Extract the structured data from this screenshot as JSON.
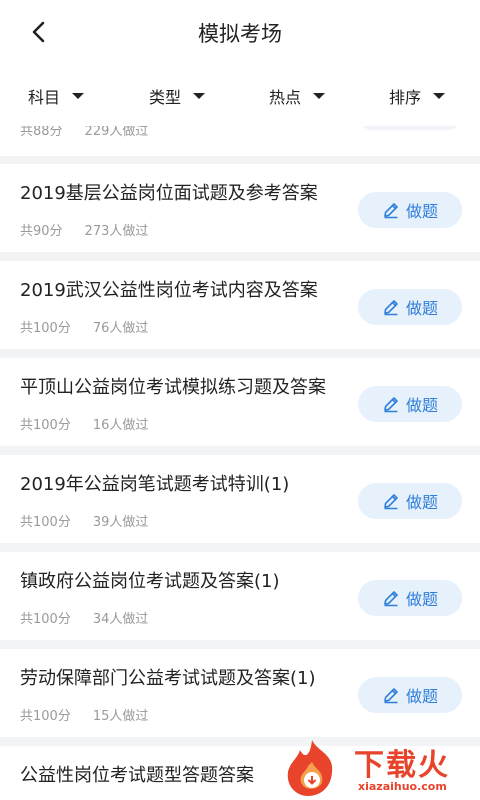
{
  "header": {
    "title": "模拟考场"
  },
  "filters": [
    {
      "label": "科目"
    },
    {
      "label": "类型"
    },
    {
      "label": "热点"
    },
    {
      "label": "排序"
    }
  ],
  "partial_top": {
    "score": "共88分",
    "views": "229人做过"
  },
  "button_label": "做题",
  "items": [
    {
      "title": "2019基层公益岗位面试题及参考答案",
      "score": "共90分",
      "views": "273人做过"
    },
    {
      "title": "2019武汉公益性岗位考试内容及答案",
      "score": "共100分",
      "views": "76人做过"
    },
    {
      "title": "平顶山公益岗位考试模拟练习题及答案",
      "score": "共100分",
      "views": "16人做过"
    },
    {
      "title": "2019年公益岗笔试题考试特训(1)",
      "score": "共100分",
      "views": "39人做过"
    },
    {
      "title": "镇政府公益岗位考试题及答案(1)",
      "score": "共100分",
      "views": "34人做过"
    },
    {
      "title": "劳动保障部门公益考试试题及答案(1)",
      "score": "共100分",
      "views": "15人做过"
    },
    {
      "title": "公益性岗位考试题型答题答案",
      "score": "",
      "views": ""
    }
  ],
  "watermark": {
    "text": "下载火",
    "url": "xiazaihuo.com"
  },
  "colors": {
    "accent": "#2f7fd9",
    "button_bg": "#e7f1fc",
    "watermark": "#e8432b"
  }
}
